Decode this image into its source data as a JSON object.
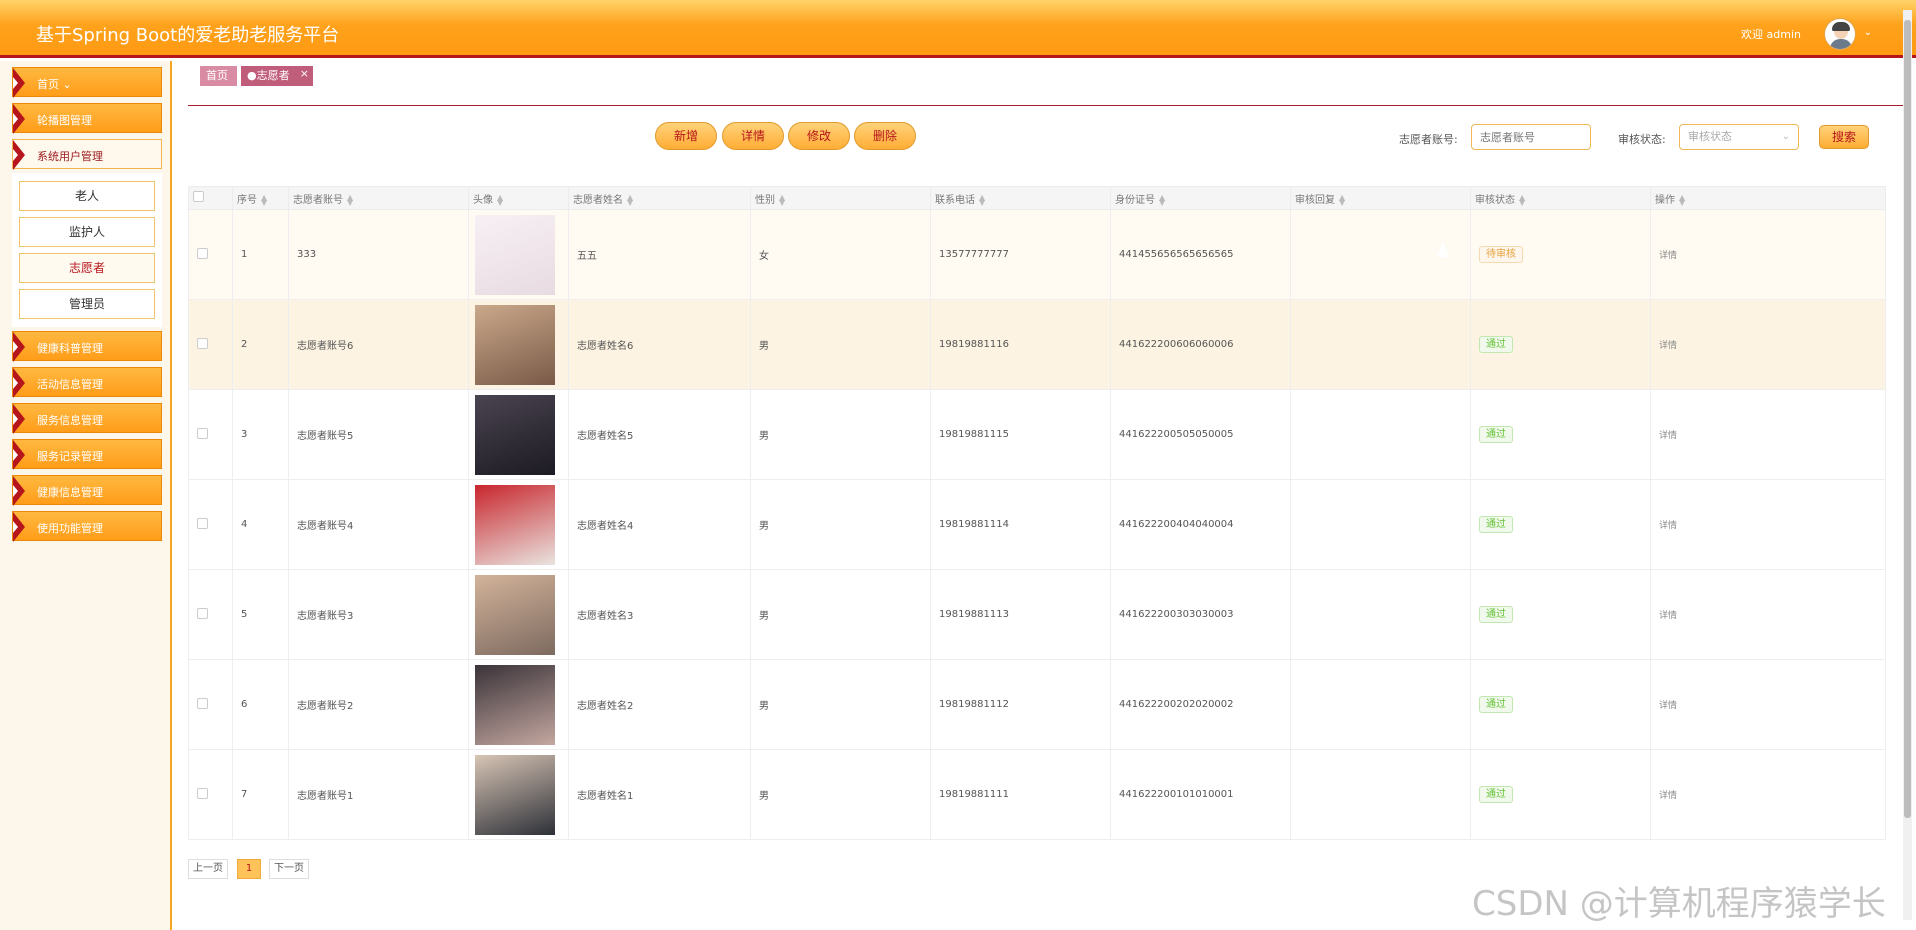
{
  "header": {
    "title": "基于Spring Boot的爱老助老服务平台",
    "welcome": "欢迎 admin"
  },
  "sidebar": {
    "items": [
      {
        "label": "首页 ⌄"
      },
      {
        "label": "轮播图管理"
      },
      {
        "label": "系统用户管理"
      },
      {
        "label": "健康科普管理"
      },
      {
        "label": "活动信息管理"
      },
      {
        "label": "服务信息管理"
      },
      {
        "label": "服务记录管理"
      },
      {
        "label": "健康信息管理"
      },
      {
        "label": "使用功能管理"
      }
    ],
    "submenu": [
      {
        "label": "老人"
      },
      {
        "label": "监护人"
      },
      {
        "label": "志愿者"
      },
      {
        "label": "管理员"
      }
    ]
  },
  "tabs": {
    "home": "首页",
    "current": "●志愿者",
    "close": "×"
  },
  "toolbar": {
    "add": "新增",
    "detail": "详情",
    "edit": "修改",
    "delete": "删除"
  },
  "search": {
    "account_label": "志愿者账号:",
    "account_placeholder": "志愿者账号",
    "status_label": "审核状态:",
    "status_placeholder": "审核状态",
    "button": "搜索"
  },
  "table": {
    "columns": [
      "序号",
      "志愿者账号",
      "头像",
      "志愿者姓名",
      "性别",
      "联系电话",
      "身份证号",
      "审核回复",
      "审核状态",
      "操作"
    ],
    "rows": [
      {
        "no": "1",
        "account": "333",
        "name": "五五",
        "gender": "女",
        "phone": "13577777777",
        "idcard": "441455656565656565",
        "reply": "",
        "status": "待审核",
        "action": "详情"
      },
      {
        "no": "2",
        "account": "志愿者账号6",
        "name": "志愿者姓名6",
        "gender": "男",
        "phone": "19819881116",
        "idcard": "441622200606060006",
        "reply": "",
        "status": "通过",
        "action": "详情"
      },
      {
        "no": "3",
        "account": "志愿者账号5",
        "name": "志愿者姓名5",
        "gender": "男",
        "phone": "19819881115",
        "idcard": "441622200505050005",
        "reply": "",
        "status": "通过",
        "action": "详情"
      },
      {
        "no": "4",
        "account": "志愿者账号4",
        "name": "志愿者姓名4",
        "gender": "男",
        "phone": "19819881114",
        "idcard": "441622200404040004",
        "reply": "",
        "status": "通过",
        "action": "详情"
      },
      {
        "no": "5",
        "account": "志愿者账号3",
        "name": "志愿者姓名3",
        "gender": "男",
        "phone": "19819881113",
        "idcard": "441622200303030003",
        "reply": "",
        "status": "通过",
        "action": "详情"
      },
      {
        "no": "6",
        "account": "志愿者账号2",
        "name": "志愿者姓名2",
        "gender": "男",
        "phone": "19819881112",
        "idcard": "441622200202020002",
        "reply": "",
        "status": "通过",
        "action": "详情"
      },
      {
        "no": "7",
        "account": "志愿者账号1",
        "name": "志愿者姓名1",
        "gender": "男",
        "phone": "19819881111",
        "idcard": "441622200101010001",
        "reply": "",
        "status": "通过",
        "action": "详情"
      }
    ]
  },
  "pagination": {
    "prev": "上一页",
    "current": "1",
    "next": "下一页"
  },
  "watermark": "CSDN @计算机程序猿学长",
  "colors": {
    "accent": "#ff9d19",
    "brand_red": "#b7151c",
    "pass": "#67c23a",
    "pending": "#e6a23c"
  }
}
